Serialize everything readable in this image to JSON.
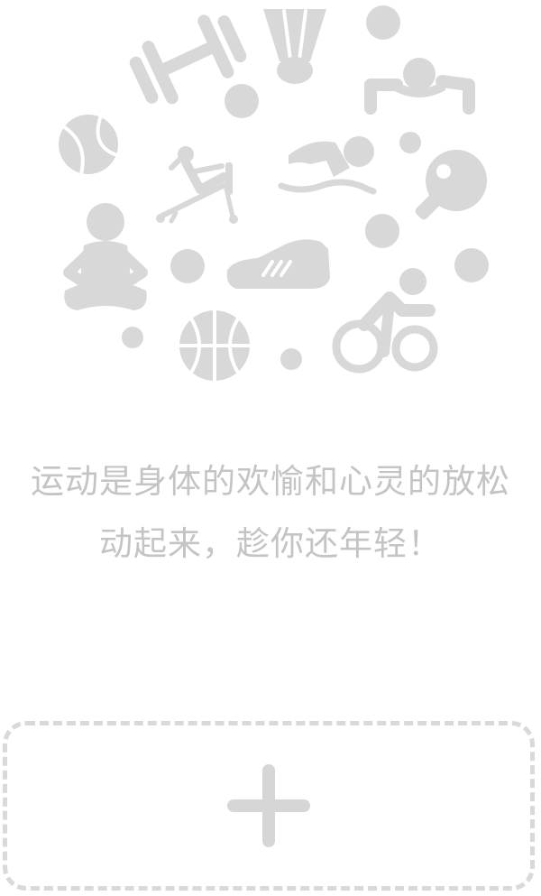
{
  "slogan": {
    "line1": "运动是身体的欢愉和心灵的放松",
    "line2": "动起来，趁你还年轻！"
  },
  "colors": {
    "icon": "#d8d8d8",
    "text": "#c4c4c4",
    "dashed_border": "#d9d9d9",
    "background": "#ffffff"
  },
  "icons": [
    "dumbbell-icon",
    "shuttlecock-icon",
    "push-up-icon",
    "tennis-ball-icon",
    "sit-up-bench-icon",
    "swimmer-icon",
    "ping-pong-paddle-icon",
    "yoga-icon",
    "sneaker-icon",
    "cyclist-icon",
    "basketball-icon",
    "dot-icon"
  ],
  "add_button": {
    "icon": "plus-icon"
  }
}
